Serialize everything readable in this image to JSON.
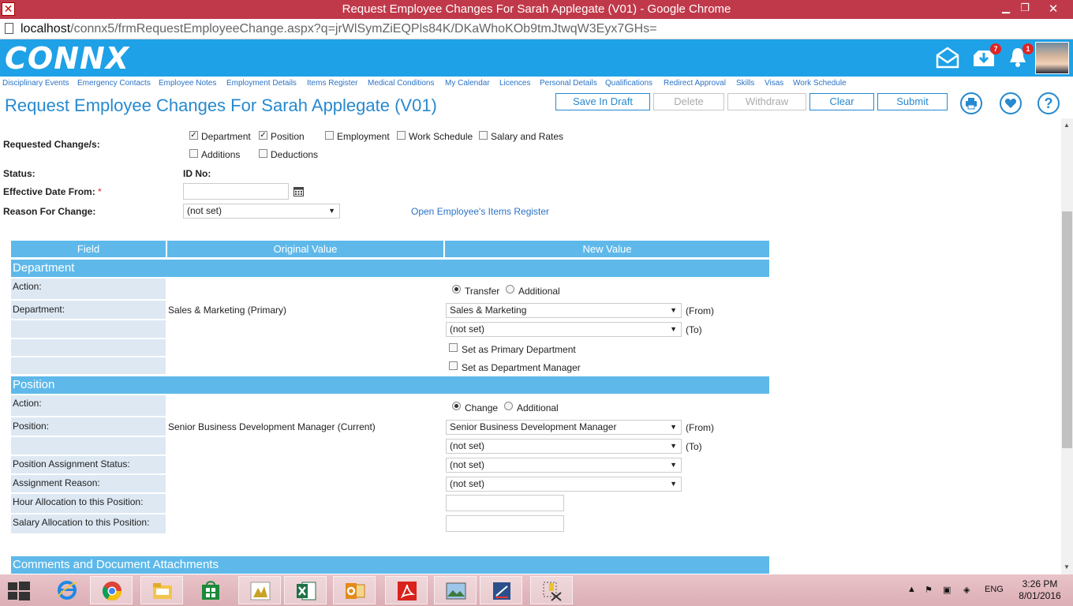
{
  "browser": {
    "window_title": "Request Employee Changes For Sarah Applegate (V01) - Google Chrome",
    "url_host": "localhost",
    "url_path": "/connx5/frmRequestEmployeeChange.aspx?q=jrWlSymZiEQPls84K/DKaWhoKOb9tmJtwqW3Eyx7GHs="
  },
  "header": {
    "logo": "CONNX",
    "download_badge": "7",
    "notification_badge": "1"
  },
  "menu": [
    "Disciplinary Events",
    "Emergency Contacts",
    "Employee Notes",
    "Employment Details",
    "Items Register",
    "Medical Conditions",
    "My Calendar",
    "Licences",
    "Personal Details",
    "Qualifications",
    "Redirect Approval",
    "Skills",
    "Visas",
    "Work Schedule"
  ],
  "page": {
    "title": "Request Employee Changes For Sarah Applegate (V01)",
    "buttons": {
      "save_draft": "Save In Draft",
      "delete": "Delete",
      "withdraw": "Withdraw",
      "clear": "Clear",
      "submit": "Submit"
    }
  },
  "form": {
    "requested_label": "Requested Change/s:",
    "options": [
      {
        "label": "Department",
        "checked": true
      },
      {
        "label": "Position",
        "checked": true
      },
      {
        "label": "Employment",
        "checked": false
      },
      {
        "label": "Work Schedule",
        "checked": false
      },
      {
        "label": "Salary and Rates",
        "checked": false
      },
      {
        "label": "Additions",
        "checked": false
      },
      {
        "label": "Deductions",
        "checked": false
      }
    ],
    "status_label": "Status:",
    "id_label": "ID No:",
    "effective_label": "Effective Date From:",
    "required_mark": "*",
    "reason_label": "Reason For Change:",
    "reason_value": "(not set)",
    "items_link": "Open Employee's Items Register"
  },
  "table": {
    "col_field": "Field",
    "col_original": "Original Value",
    "col_new": "New Value"
  },
  "department": {
    "section": "Department",
    "action_label": "Action:",
    "transfer": "Transfer",
    "additional": "Additional",
    "dept_label": "Department:",
    "original": "Sales & Marketing (Primary)",
    "from_value": "Sales & Marketing",
    "from_tag": "(From)",
    "to_value": "(not set)",
    "to_tag": "(To)",
    "set_primary": "Set as Primary Department",
    "set_manager": "Set as Department Manager"
  },
  "position": {
    "section": "Position",
    "action_label": "Action:",
    "change": "Change",
    "additional": "Additional",
    "pos_label": "Position:",
    "original": "Senior Business Development Manager (Current)",
    "from_value": "Senior Business Development Manager",
    "from_tag": "(From)",
    "to_value": "(not set)",
    "to_tag": "(To)",
    "assign_status_label": "Position Assignment Status:",
    "assign_status_value": "(not set)",
    "assign_reason_label": "Assignment Reason:",
    "assign_reason_value": "(not set)",
    "hour_label": "Hour Allocation to this Position:",
    "salary_label": "Salary Allocation to this Position:"
  },
  "comments": {
    "section": "Comments and Document Attachments"
  },
  "taskbar": {
    "lang": "ENG",
    "time": "3:26 PM",
    "date": "8/01/2016"
  }
}
